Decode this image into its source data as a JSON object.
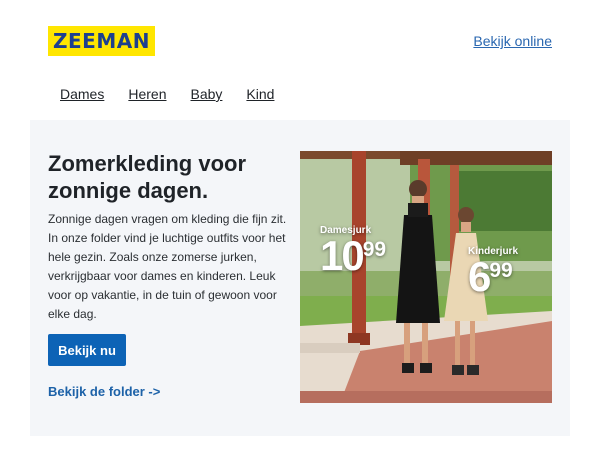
{
  "header": {
    "logo_text": "ZEEMAN",
    "view_online": "Bekijk online"
  },
  "nav": [
    "Dames",
    "Heren",
    "Baby",
    "Kind"
  ],
  "hero": {
    "title": "Zomerkleding voor zonnige dagen.",
    "body": "Zonnige dagen vragen om kleding die fijn zit. In onze folder vind je luchtige outfits voor het hele gezin. Zoals onze zomerse jurken, verkrijgbaar voor dames en kinderen. Leuk voor op vakantie, in de tuin of gewoon voor elke dag.",
    "cta_button": "Bekijk nu",
    "folder_link": "Bekijk de folder ->"
  },
  "photo": {
    "price_1": {
      "label": "Damesjurk",
      "int": "10",
      "dec": "99"
    },
    "price_2": {
      "label": "Kinderjurk",
      "int": "6",
      "dec": "99"
    }
  },
  "colors": {
    "brand_yellow": "#ffe600",
    "brand_blue": "#1d3f8f",
    "button_blue": "#0d63b6",
    "hero_bg": "#f4f6f9"
  }
}
